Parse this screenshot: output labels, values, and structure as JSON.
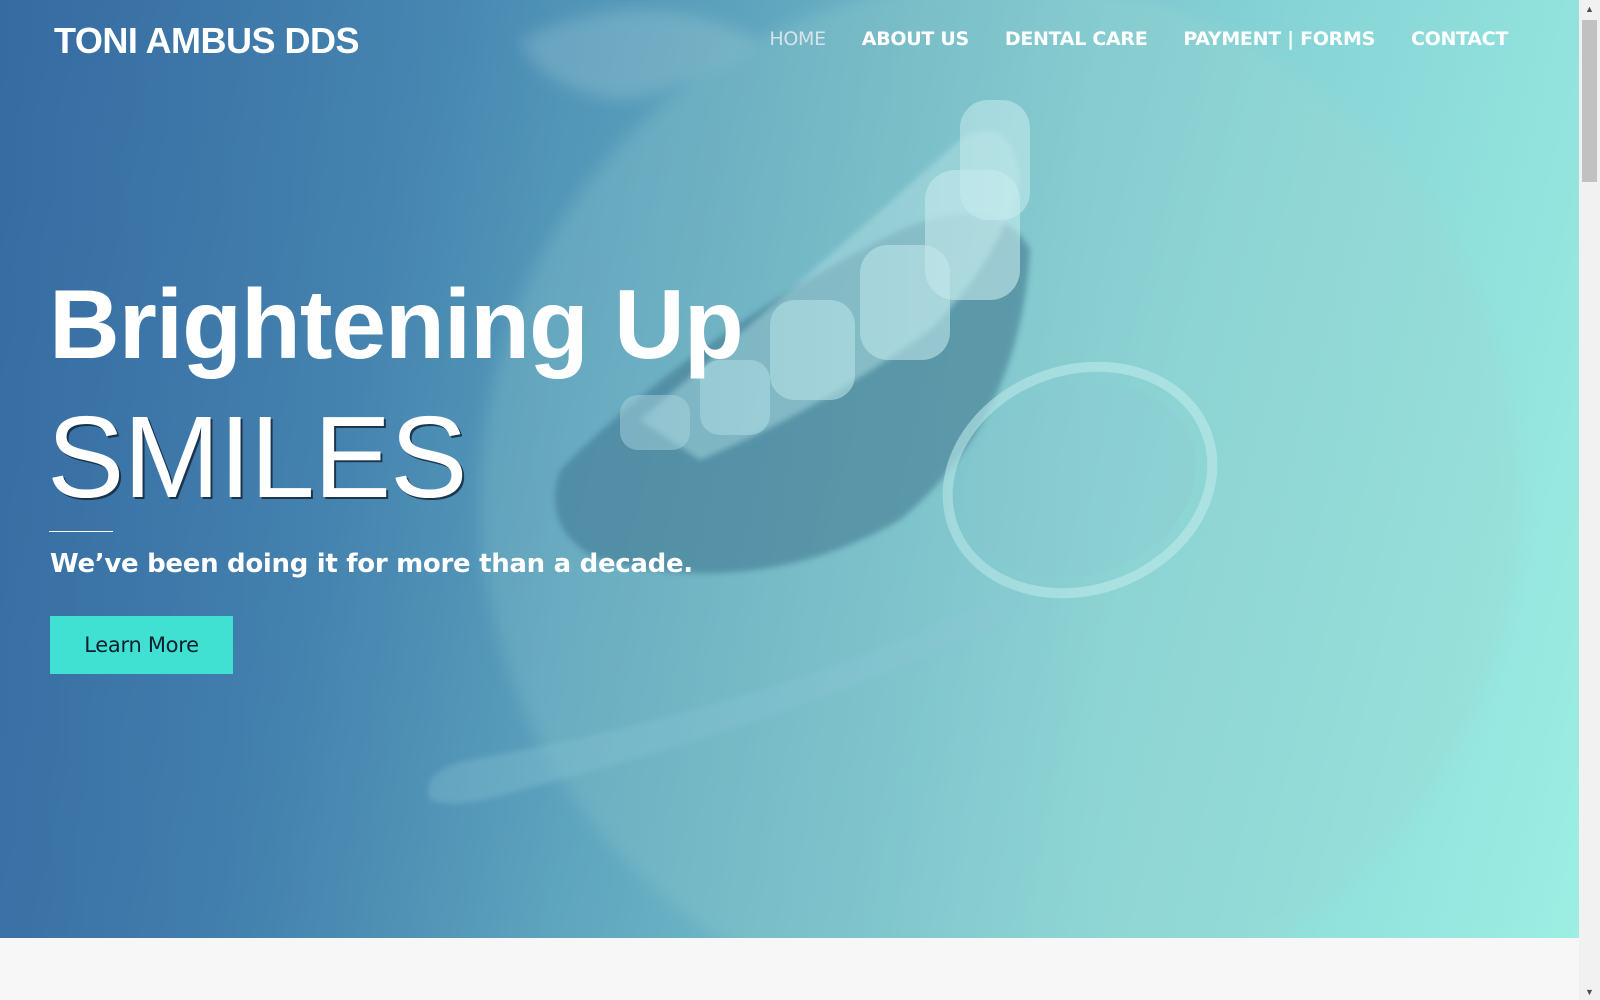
{
  "site": {
    "logo": "TONI AMBUS DDS"
  },
  "nav": {
    "items": [
      {
        "label": "HOME",
        "active": true
      },
      {
        "label": "ABOUT US",
        "active": false
      },
      {
        "label": "DENTAL CARE",
        "active": false
      },
      {
        "label": "PAYMENT | FORMS",
        "active": false
      },
      {
        "label": "CONTACT",
        "active": false
      }
    ]
  },
  "hero": {
    "headline_line1": "Brightening Up",
    "headline_line2": "SMILES",
    "tagline": "We’ve been doing it for more than a decade.",
    "cta_label": "Learn More"
  },
  "colors": {
    "cta_background": "#40e0d3",
    "hero_gradient_start": "#3b73a4",
    "hero_gradient_end": "#9cefe3",
    "page_background": "#f7f7f7"
  },
  "scrollbar": {
    "up_icon": "triangle-up-icon",
    "down_icon": "triangle-down-icon"
  }
}
